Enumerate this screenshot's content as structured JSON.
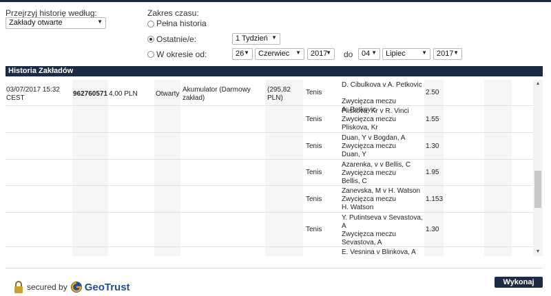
{
  "filter": {
    "browse_label": "Przejrzyj historię według:",
    "browse_value": "Zakłady otwarte",
    "range_label": "Zakres czasu:",
    "full_history": "Pełna historia",
    "last_label": "Ostatnie/e:",
    "last_value": "1 Tydzień",
    "period_label": "W okresie od:",
    "from_day": "26",
    "from_month": "Czerwiec",
    "from_year": "2017",
    "to_label": "do",
    "to_day": "04",
    "to_month": "Lipiec",
    "to_year": "2017",
    "selected_range": "last"
  },
  "panel_title": "Historia Zakładów",
  "bet": {
    "datetime": "03/07/2017 15:32",
    "timezone": "CEST",
    "id": "962760571",
    "stake": "4,00 PLN",
    "status": "Otwarty",
    "type": "Akumulator (Darmowy zakład)",
    "payout": "(295,82 PLN)"
  },
  "selections": [
    {
      "sport": "Tenis",
      "event": "D. Cibulkova v A. Petkovic",
      "market": "Zwycięzca meczu",
      "pick": "A. Petkovic",
      "odds": "2.50"
    },
    {
      "sport": "Tenis",
      "event": "Pliskova, Kr v R. Vinci",
      "market": "Zwycięzca meczu",
      "pick": "Pliskova, Kr",
      "odds": "1.55"
    },
    {
      "sport": "Tenis",
      "event": "Duan, Y v Bogdan, A",
      "market": "Zwycięzca meczu",
      "pick": "Duan, Y",
      "odds": "1.30"
    },
    {
      "sport": "Tenis",
      "event": "Azarenka, v v Bellis, C",
      "market": "Zwycięzca meczu",
      "pick": "Bellis, C",
      "odds": "1.95"
    },
    {
      "sport": "Tenis",
      "event": "Zanevska, M v H. Watson",
      "market": "Zwycięzca meczu",
      "pick": "H. Watson",
      "odds": "1.153"
    },
    {
      "sport": "Tenis",
      "event": "Y. Putintseva v Sevastova, A",
      "market": "Zwycięzca meczu",
      "pick": "Sevastova, A",
      "odds": "1.30"
    },
    {
      "sport": "",
      "event": "E. Vesnina v Blinkova, A",
      "market": "",
      "pick": "",
      "odds": ""
    }
  ],
  "footer": {
    "secured_by": "secured by",
    "brand": "GeoTrust",
    "submit": "Wykonaj"
  }
}
